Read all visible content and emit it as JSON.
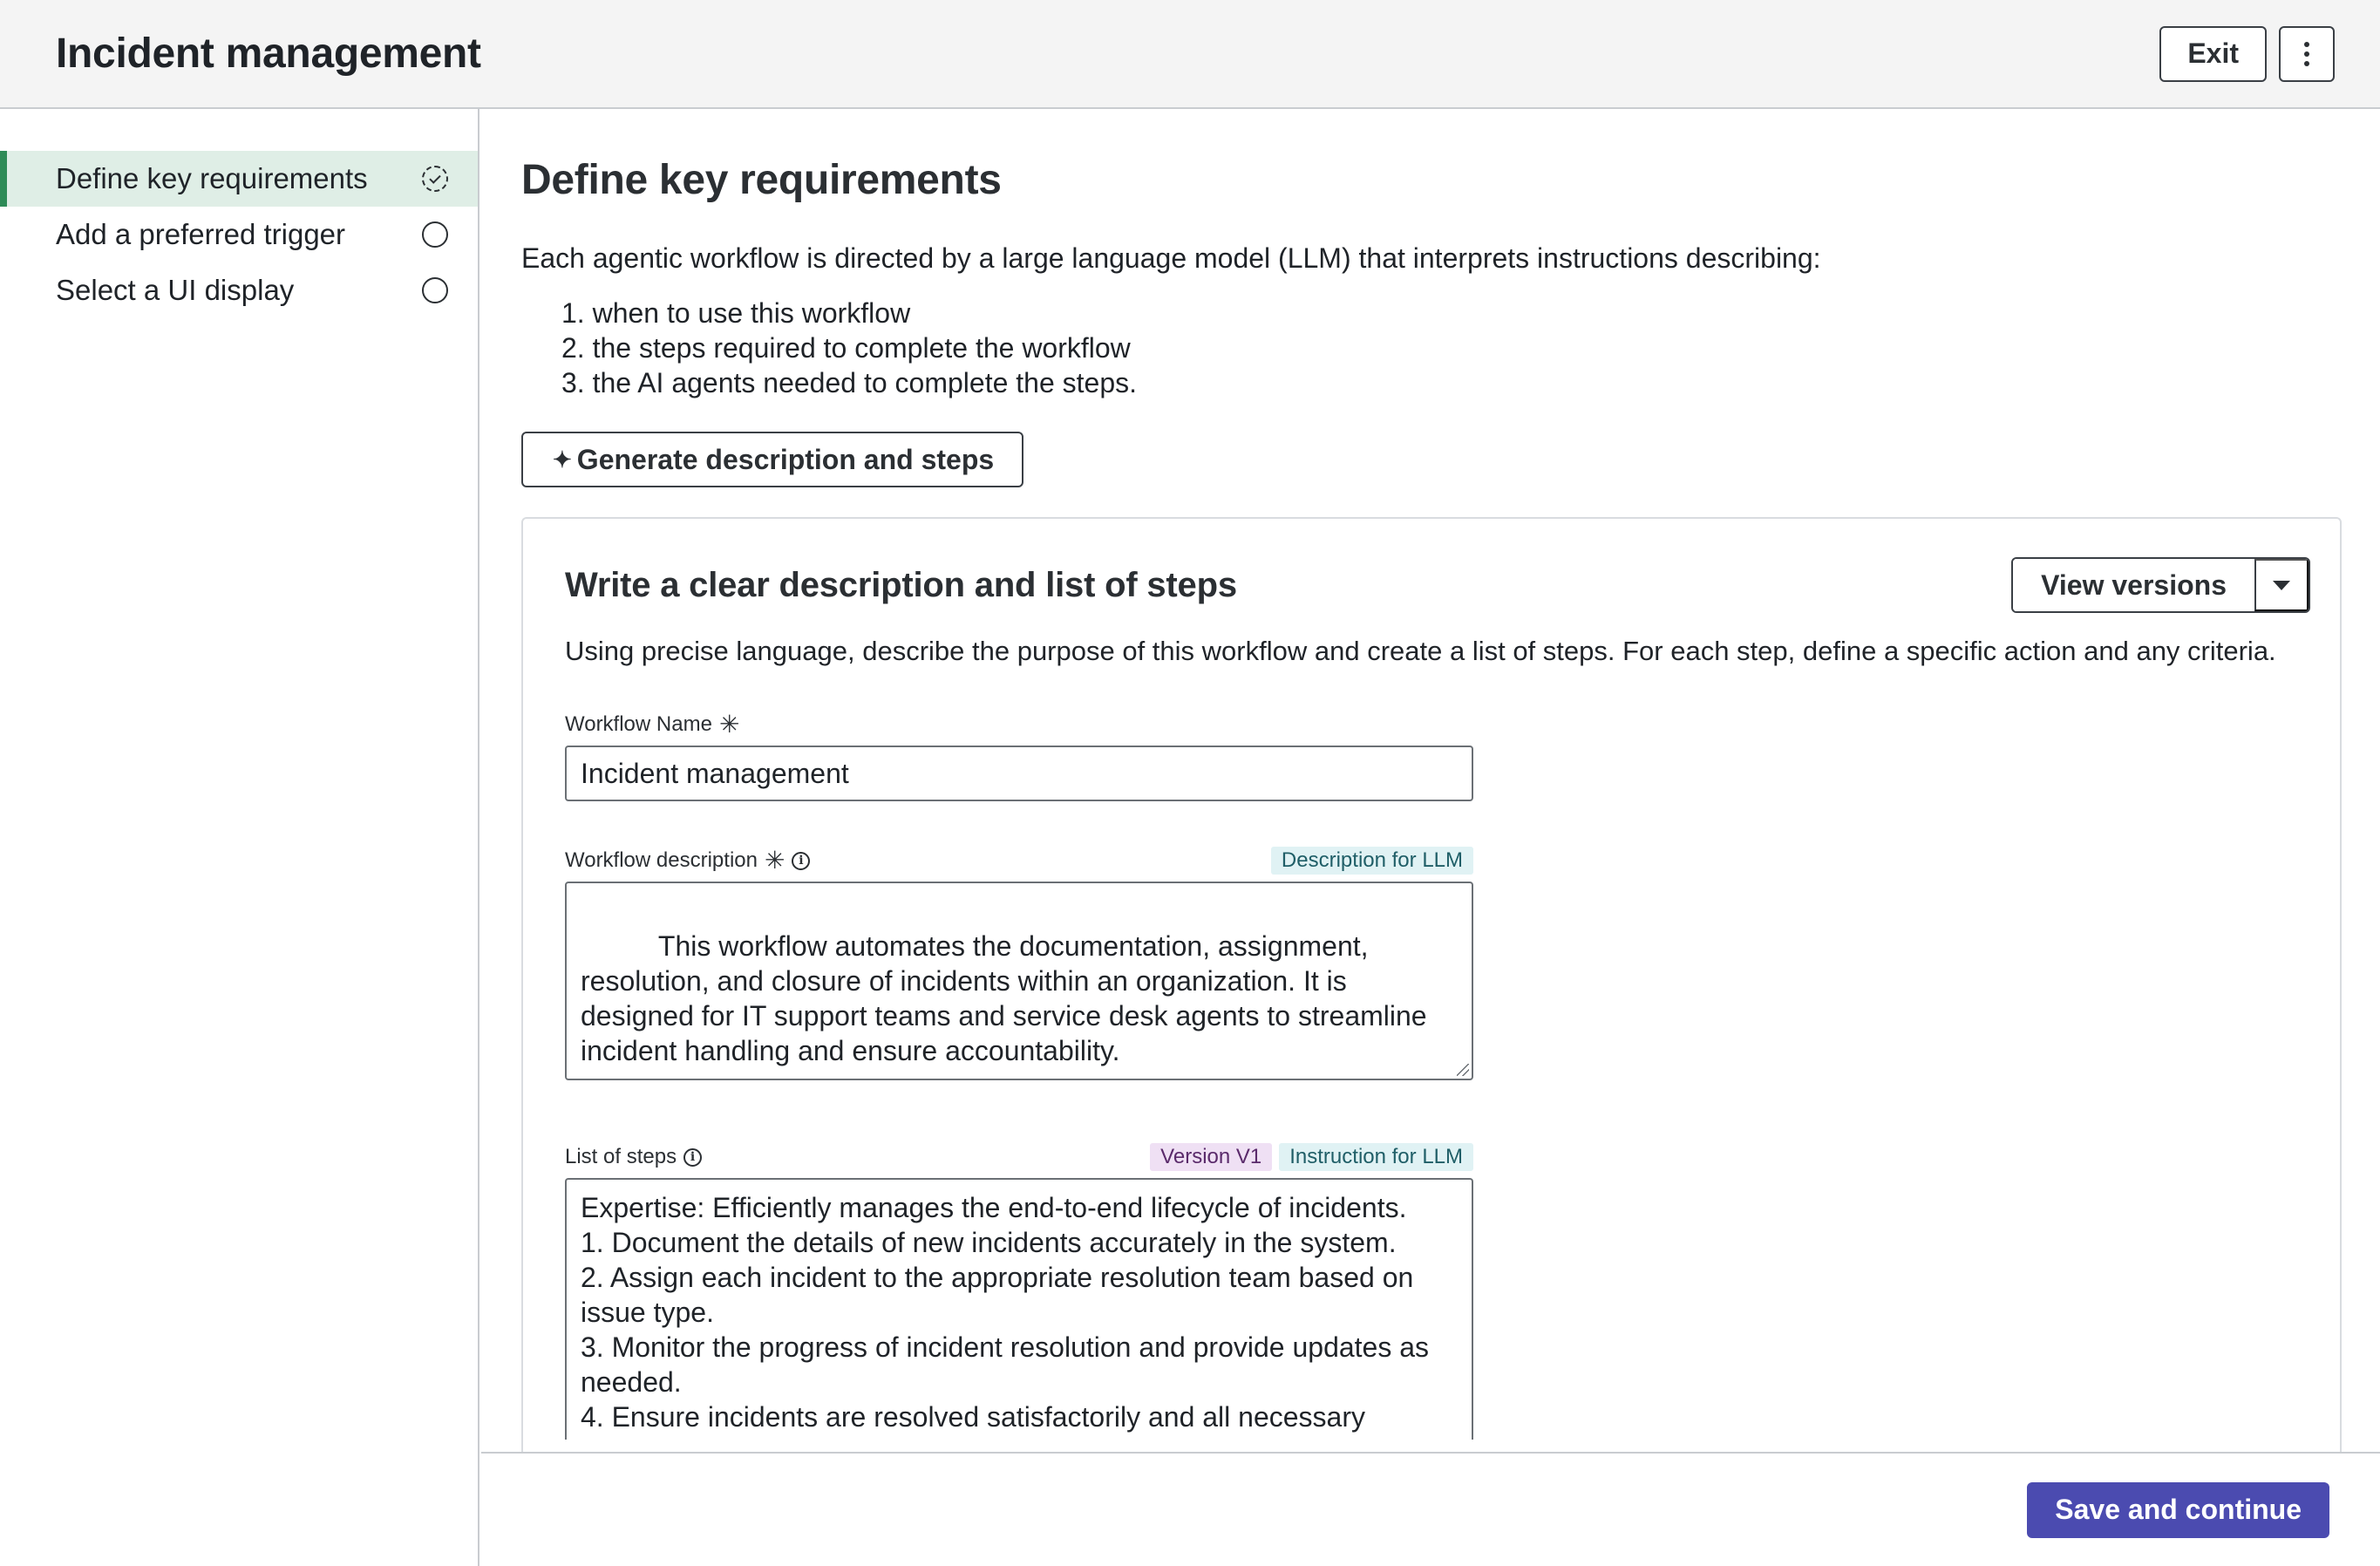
{
  "header": {
    "title": "Incident management",
    "exit_label": "Exit"
  },
  "sidebar": {
    "steps": [
      {
        "label": "Define key requirements",
        "state": "in-progress"
      },
      {
        "label": "Add a preferred trigger",
        "state": "not-started"
      },
      {
        "label": "Select a UI display",
        "state": "not-started"
      }
    ]
  },
  "main": {
    "title": "Define key requirements",
    "intro": "Each agentic workflow is directed by a large language model (LLM) that interprets instructions describing:",
    "requirements": [
      "1. when to use this workflow",
      "2. the steps required to complete the workflow",
      "3. the AI agents needed to complete the steps."
    ],
    "generate_label": "Generate description and steps",
    "card": {
      "title": "Write a clear description and list of steps",
      "view_versions_label": "View versions",
      "description": "Using precise language, describe the purpose of this workflow and create a list of steps. For each step, define a specific action and any criteria.",
      "workflow_name": {
        "label": "Workflow Name",
        "value": "Incident management"
      },
      "workflow_description": {
        "label": "Workflow description",
        "tag": "Description for LLM",
        "value": "This workflow automates the documentation, assignment, resolution, and closure of incidents within an organization. It is designed for IT support teams and service desk agents to streamline incident handling and ensure accountability."
      },
      "list_of_steps": {
        "label": "List of steps",
        "version_tag": "Version V1",
        "tag": "Instruction for LLM",
        "value": "Expertise: Efficiently manages the end-to-end lifecycle of incidents.\n1. Document the details of new incidents accurately in the system.\n2. Assign each incident to the appropriate resolution team based on issue type.\n3. Monitor the progress of incident resolution and provide updates as needed.\n4. Ensure incidents are resolved satisfactorily and all necessary"
      }
    }
  },
  "footer": {
    "save_label": "Save and continue"
  },
  "colors": {
    "accent": "#4b4bb0",
    "active_step_bg": "#dfeee6",
    "active_step_bar": "#2e8b57",
    "tag_llm_bg": "#e0f2f4",
    "tag_version_bg": "#efe0f4"
  },
  "icons": {
    "more": "more-vertical-icon",
    "in_progress": "in-progress-check-icon",
    "not_started": "empty-circle-icon",
    "sparkle": "sparkle-icon",
    "dropdown": "caret-down-icon",
    "info": "info-icon",
    "required": "asterisk-icon"
  }
}
